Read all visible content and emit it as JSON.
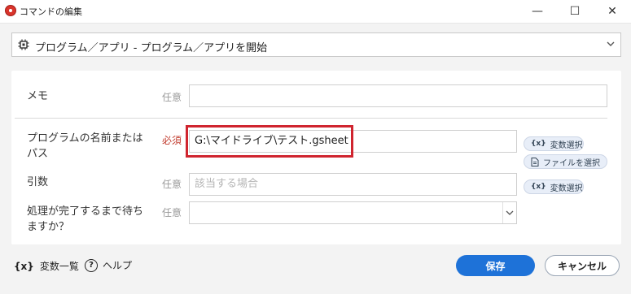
{
  "window": {
    "title": "コマンドの編集",
    "minimize": "—",
    "maximize": "☐",
    "close": "✕"
  },
  "action": {
    "label": "プログラム／アプリ - プログラム／アプリを開始",
    "icon": "chip-icon"
  },
  "form": {
    "memo": {
      "label": "メモ",
      "requirement": "任意",
      "value": ""
    },
    "program_path": {
      "label_line1": "プログラムの名前または",
      "label_line2": "パス",
      "requirement": "必須",
      "value": "G:\\マイドライブ\\テスト.gsheet"
    },
    "arguments": {
      "label": "引数",
      "requirement": "任意",
      "placeholder": "該当する場合"
    },
    "wait": {
      "label_line1": "処理が完了するまで待ち",
      "label_line2": "ますか？",
      "requirement": "任意",
      "value": ""
    },
    "variable_select_label": "変数選択",
    "file_select_label": "ファイルを選択",
    "variable_icon_text": "{x}"
  },
  "footer": {
    "variables_icon_text": "{x}",
    "variables_label": "変数一覧",
    "help_icon_text": "?",
    "help_label": "ヘルプ",
    "save_label": "保存",
    "cancel_label": "キャンセル"
  },
  "colors": {
    "primary": "#1e72d8",
    "required": "#c0392b",
    "highlight": "#d0252f"
  }
}
